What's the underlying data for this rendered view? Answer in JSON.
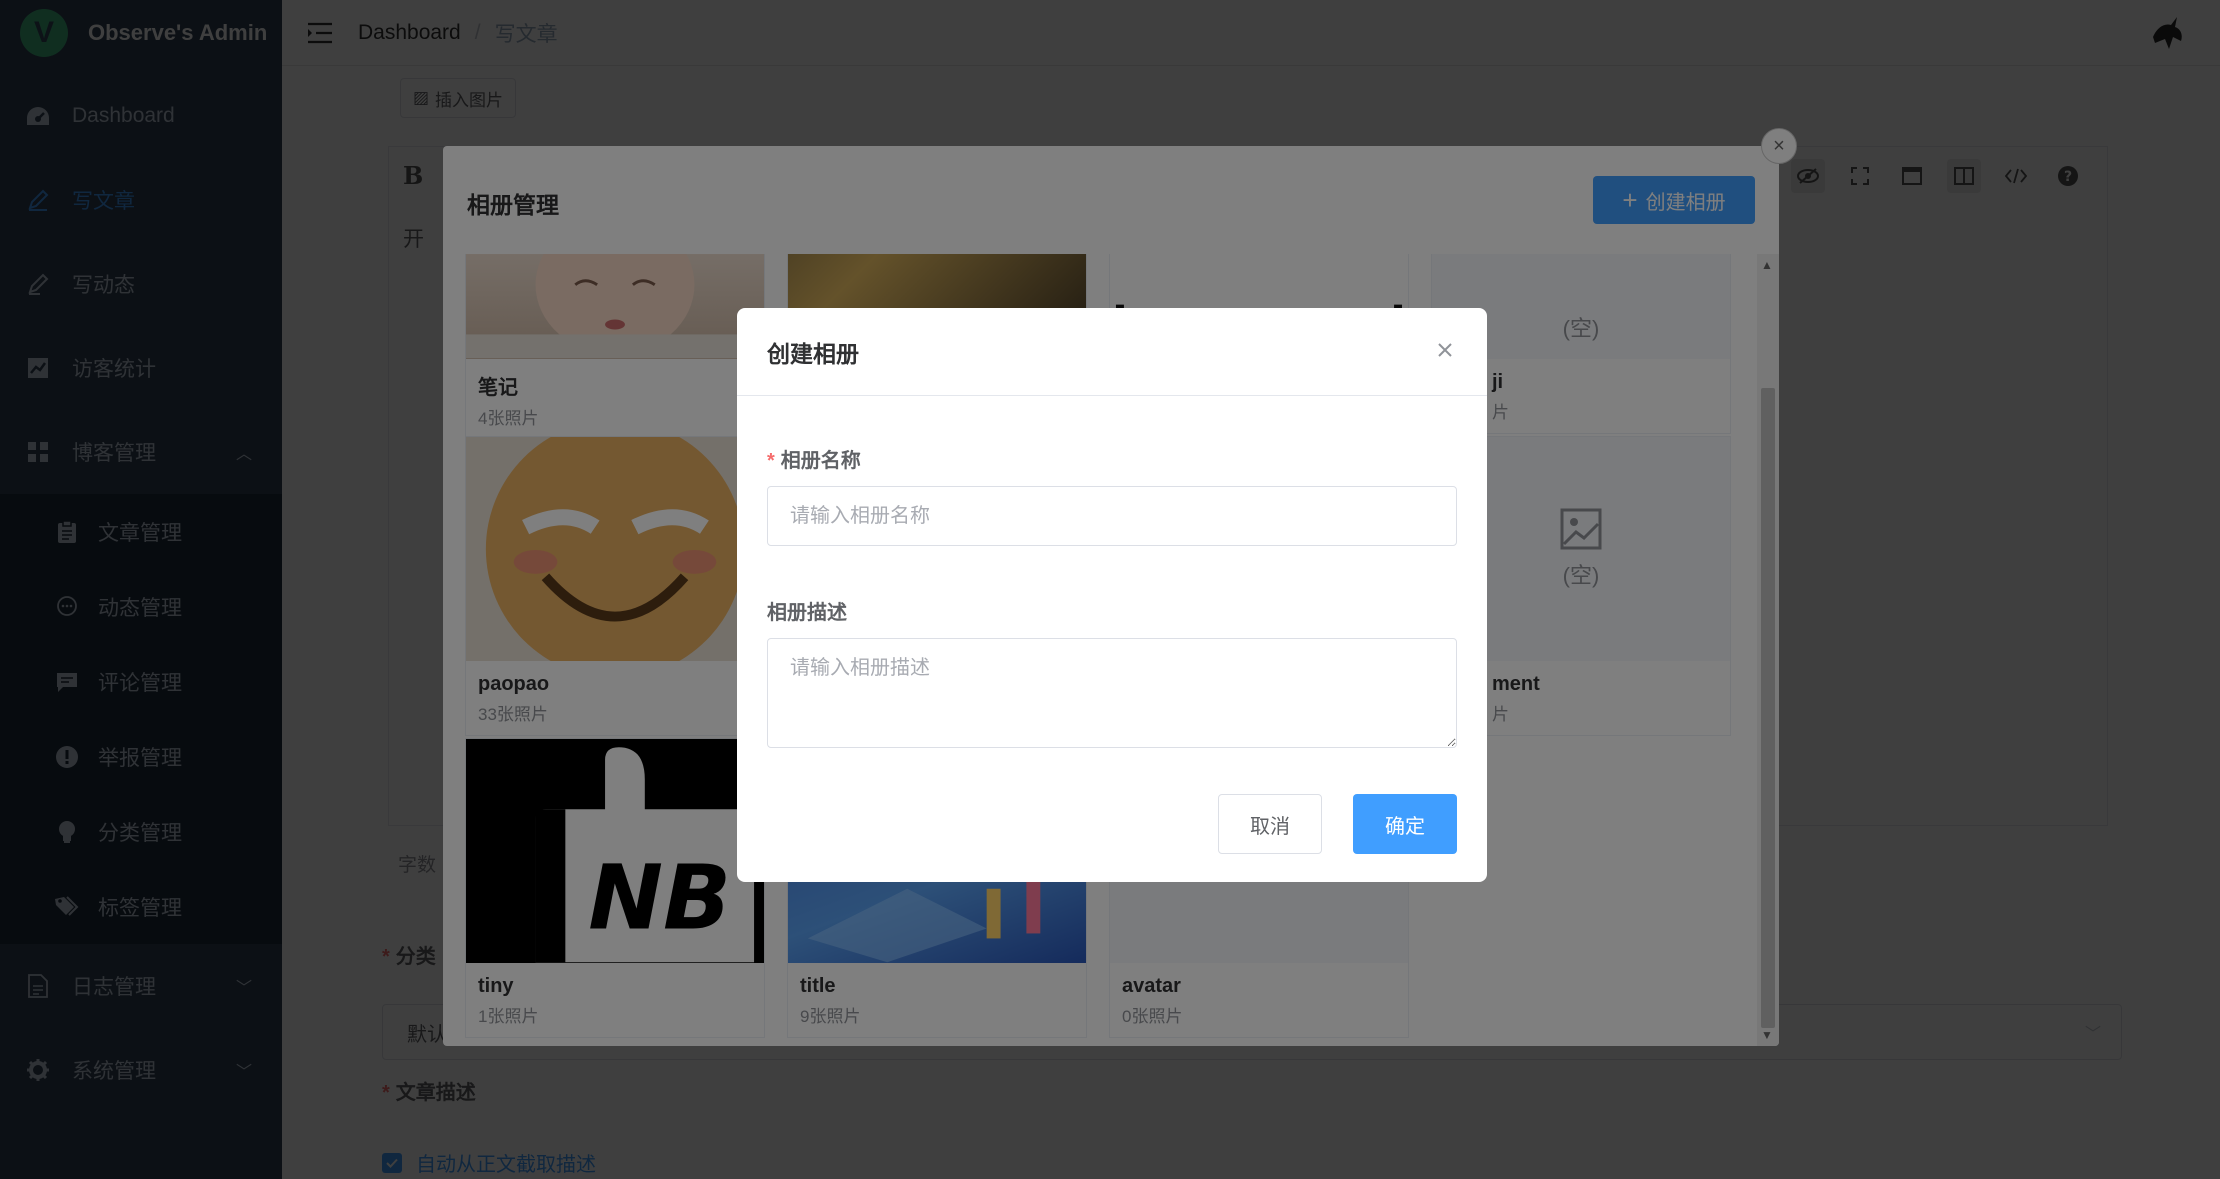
{
  "brand": {
    "logo_letter": "V",
    "name": "Observe's Admin"
  },
  "sidebar": {
    "items": [
      {
        "label": "Dashboard",
        "icon": "dashboard-icon"
      },
      {
        "label": "写文章",
        "icon": "edit-icon",
        "active": true
      },
      {
        "label": "写动态",
        "icon": "pen-icon"
      },
      {
        "label": "访客统计",
        "icon": "chart-icon"
      },
      {
        "label": "博客管理",
        "icon": "grid-icon",
        "expanded": true
      },
      {
        "label": "日志管理",
        "icon": "document-icon"
      },
      {
        "label": "系统管理",
        "icon": "gear-icon"
      }
    ],
    "subitems": [
      {
        "label": "文章管理",
        "icon": "clipboard-icon"
      },
      {
        "label": "动态管理",
        "icon": "chat-bubble-icon"
      },
      {
        "label": "评论管理",
        "icon": "comment-icon"
      },
      {
        "label": "举报管理",
        "icon": "warning-icon"
      },
      {
        "label": "分类管理",
        "icon": "bulb-icon"
      },
      {
        "label": "标签管理",
        "icon": "tag-icon"
      }
    ]
  },
  "header": {
    "breadcrumb": [
      "Dashboard",
      "写文章"
    ],
    "separator": "/"
  },
  "editor": {
    "insert_image": "插入图片",
    "bold": "B",
    "body_text": "开",
    "wordcount": "字数",
    "category_label": "分类",
    "category_value": "默认",
    "desc_label": "文章描述",
    "auto_desc": "自动从正文截取描述"
  },
  "album_dialog": {
    "title": "相册管理",
    "create_button": "创建相册",
    "close_symbol": "×",
    "empty_text": "(空)",
    "albums": [
      {
        "name": "笔记",
        "count": "4张照片"
      },
      {
        "name": "ji",
        "count": "片"
      },
      {
        "name": "paopao",
        "count": "33张照片"
      },
      {
        "name": "ment",
        "count": "片"
      },
      {
        "name": "tiny",
        "count": "1张照片",
        "image_text": "NB"
      },
      {
        "name": "title",
        "count": "9张照片"
      },
      {
        "name": "avatar",
        "count": "0张照片"
      }
    ]
  },
  "create_dialog": {
    "title": "创建相册",
    "name_label": "相册名称",
    "name_placeholder": "请输入相册名称",
    "desc_label": "相册描述",
    "desc_placeholder": "请输入相册描述",
    "cancel": "取消",
    "confirm": "确定",
    "required_mark": "*"
  },
  "colors": {
    "primary": "#409eff",
    "sidebar_bg": "#304156",
    "danger": "#f56c6c"
  }
}
